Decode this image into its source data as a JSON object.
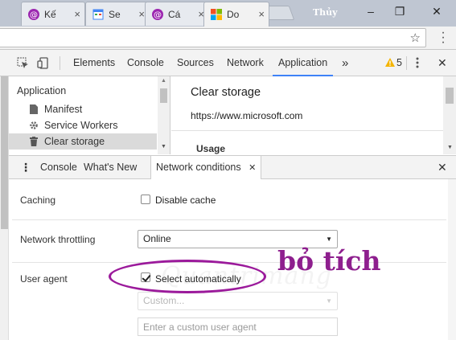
{
  "browser": {
    "tabs": [
      {
        "label": "Kế",
        "favicon": "at-icon",
        "color": "#9c27b0"
      },
      {
        "label": "Se",
        "favicon": "calendar-page-icon",
        "color": "#4285f4"
      },
      {
        "label": "Cá",
        "favicon": "at-icon",
        "color": "#9c27b0"
      },
      {
        "label": "Do",
        "favicon": "microsoft-logo-icon",
        "color": "#f25022"
      }
    ],
    "close_glyph": "×",
    "profile_name": "Thủy",
    "window_controls": {
      "minimize": "–",
      "restore": "❐",
      "close": "✕"
    },
    "address_bar": {
      "value": "",
      "bookmark_glyph": "☆"
    }
  },
  "devtools": {
    "tabs": [
      "Elements",
      "Console",
      "Sources",
      "Network",
      "Application"
    ],
    "active_tab": "Application",
    "more_tabs_glyph": "»",
    "warning_count": "5",
    "close_glyph": "✕",
    "application": {
      "sidebar_heading": "Application",
      "items": [
        {
          "label": "Manifest",
          "icon": "document-icon"
        },
        {
          "label": "Service Workers",
          "icon": "gear-icon"
        },
        {
          "label": "Clear storage",
          "icon": "trash-icon"
        }
      ],
      "selected_item": "Clear storage",
      "main_title": "Clear storage",
      "origin": "https://www.microsoft.com",
      "section": "Usage"
    },
    "drawer": {
      "menu_glyph": "⋮",
      "tabs": [
        "Console",
        "What's New",
        "Network conditions"
      ],
      "active_tab": "Network conditions",
      "close_glyph": "✕",
      "network_conditions": {
        "caching_label": "Caching",
        "disable_cache_label": "Disable cache",
        "disable_cache_checked": false,
        "throttling_label": "Network throttling",
        "throttling_value": "Online",
        "user_agent_label": "User agent",
        "select_automatically_label": "Select automatically",
        "select_automatically_checked": true,
        "custom_select_value": "Custom...",
        "custom_ua_placeholder": "Enter a custom user agent"
      }
    }
  },
  "watermark": "Quantrimang",
  "annotation": {
    "text": "bỏ tích",
    "color": "#8e1f8e"
  }
}
